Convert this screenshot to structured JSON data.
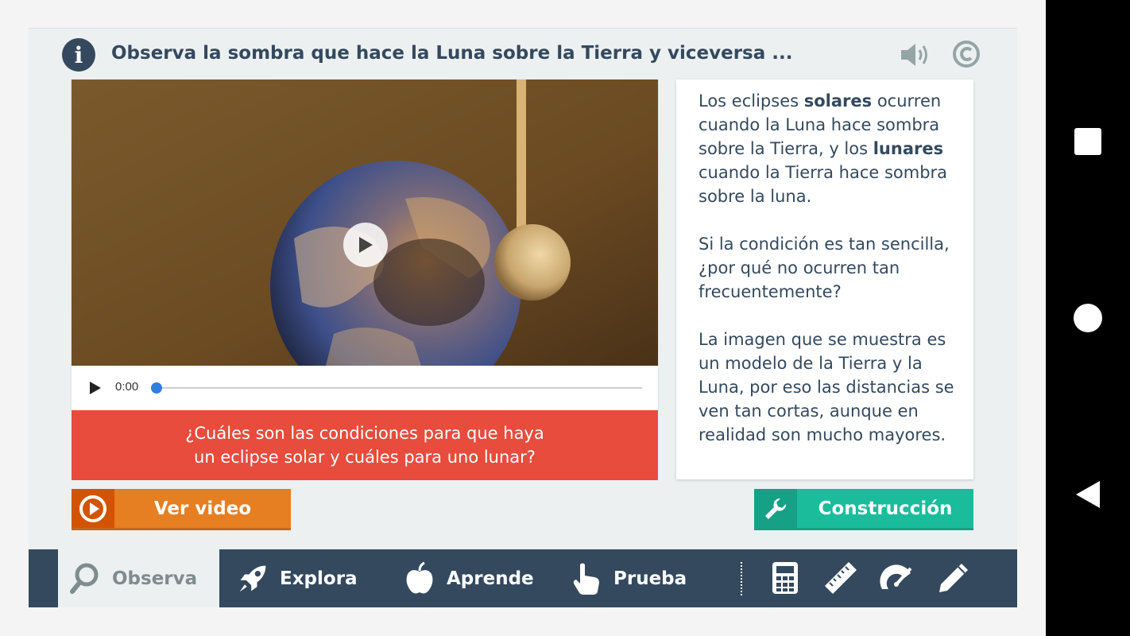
{
  "header": {
    "title": "Observa la sombra que hace la Luna sobre la Tierra y viceversa ..."
  },
  "video": {
    "time": "0:00",
    "progress": 0
  },
  "question": {
    "line1": "¿Cuáles son las condiciones para que haya",
    "line2": "un eclipse solar y cuáles para uno lunar?"
  },
  "text_panel": {
    "p1_a": "Los eclipses ",
    "p1_b": "solares",
    "p1_c": " ocurren cuando la Luna hace sombra sobre la Tierra, y los ",
    "p1_d": "lunares",
    "p1_e": " cuando la Tierra hace sombra sobre la luna.",
    "p2": "Si la condición es tan sencilla, ¿por qué no ocurren tan frecuentemente?",
    "p3": "La imagen que se muestra es un modelo de la Tierra y la Luna, por eso las distancias se ven tan cortas, aunque en realidad son mucho mayores."
  },
  "buttons": {
    "video_label": "Ver video",
    "build_label": "Construcción"
  },
  "nav": {
    "items": [
      {
        "label": "Observa",
        "icon": "search-icon",
        "active": true
      },
      {
        "label": "Explora",
        "icon": "rocket-icon",
        "active": false
      },
      {
        "label": "Aprende",
        "icon": "apple-icon",
        "active": false
      },
      {
        "label": "Prueba",
        "icon": "hand-pointer-icon",
        "active": false
      }
    ],
    "tools": [
      "calculator-icon",
      "ruler-icon",
      "protractor-icon",
      "pencil-icon"
    ]
  },
  "colors": {
    "header_text": "#34495e",
    "question_bg": "#e74c3c",
    "video_button": "#e67e22",
    "build_button": "#1abc9c",
    "nav_bg": "#34495e"
  }
}
